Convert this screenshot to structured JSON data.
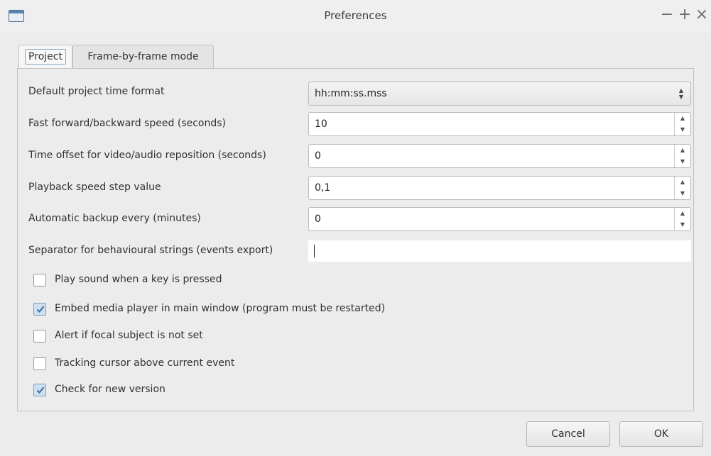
{
  "window": {
    "title": "Preferences",
    "controls": {
      "minimize": "−",
      "maximize": "+",
      "close": "×"
    }
  },
  "tabs": [
    {
      "label": "Project",
      "active": true
    },
    {
      "label": "Frame-by-frame mode",
      "active": false
    }
  ],
  "settings": {
    "time_format": {
      "label": "Default project time format",
      "value": "hh:mm:ss.mss"
    },
    "ff_speed": {
      "label": "Fast forward/backward speed (seconds)",
      "value": "10"
    },
    "time_offset": {
      "label": "Time offset for video/audio reposition (seconds)",
      "value": "0"
    },
    "playback_step": {
      "label": "Playback speed step value",
      "value": "0,1"
    },
    "auto_backup": {
      "label": "Automatic backup every (minutes)",
      "value": "0"
    },
    "separator": {
      "label": "Separator for behavioural strings (events export)",
      "value": ""
    }
  },
  "checkboxes": [
    {
      "label": "Play sound when a key is pressed",
      "checked": false
    },
    {
      "label": "Embed media player in main window (program must be restarted)",
      "checked": true
    },
    {
      "label": "Alert if focal subject is not set",
      "checked": false
    },
    {
      "label": "Tracking cursor above current event",
      "checked": false
    },
    {
      "label": "Check for new version",
      "checked": true
    }
  ],
  "buttons": {
    "cancel": "Cancel",
    "ok": "OK"
  },
  "icons": {
    "app": "window-icon",
    "spin_up": "▲",
    "spin_down": "▼",
    "check": "checkmark-icon"
  },
  "colors": {
    "accent": "#7d9cc2",
    "check_fill": "#cfe0f1",
    "check_mark": "#3f6a99"
  }
}
